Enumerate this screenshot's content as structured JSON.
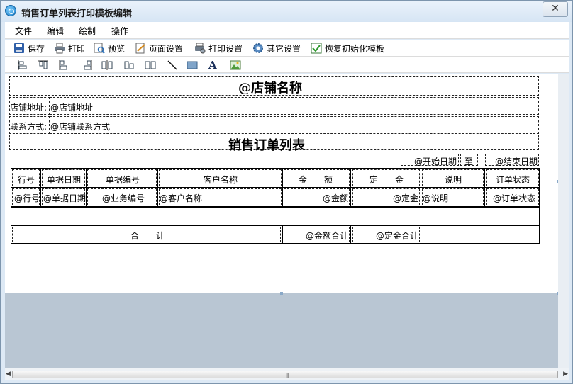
{
  "window": {
    "title": "销售订单列表打印模板编辑",
    "close_label": "✕"
  },
  "menu": [
    "文件",
    "编辑",
    "绘制",
    "操作"
  ],
  "toolbar": [
    {
      "icon": "save-icon",
      "label": "保存"
    },
    {
      "icon": "print-icon",
      "label": "打印"
    },
    {
      "icon": "preview-icon",
      "label": "预览"
    },
    {
      "icon": "page-setup-icon",
      "label": "页面设置"
    },
    {
      "icon": "print-setup-icon",
      "label": "打印设置"
    },
    {
      "icon": "gear-icon",
      "label": "其它设置"
    },
    {
      "icon": "restore-icon",
      "label": "恢复初始化模板"
    }
  ],
  "drawbar": [
    "align-left-icon",
    "align-top-icon",
    "align-bottom-left-icon",
    "align-bottom-right-icon",
    "distribute-h-icon",
    "same-height-icon",
    "same-width-icon",
    "line-icon",
    "rectangle-icon",
    "text-icon",
    "image-icon"
  ],
  "template": {
    "shop_name": "@店铺名称",
    "address_label": "店铺地址:",
    "address_value": "@店铺地址",
    "contact_label": "联系方式:",
    "contact_value": "@店铺联系方式",
    "report_title": "销售订单列表",
    "start_date": "@开始日期",
    "to_label": "至",
    "end_date": "@结束日期",
    "headers": [
      "行号",
      "单据日期",
      "单据编号",
      "客户名称",
      "金　　额",
      "定　　金",
      "说明",
      "订单状态"
    ],
    "row": [
      "@行号",
      "@单据日期",
      "@业务编号",
      "@客户名称",
      "@金额",
      "@定金",
      "@说明",
      "@订单状态"
    ],
    "total_label": "合　　计",
    "total_amount": "@金额合计",
    "total_deposit": "@定金合计"
  },
  "scrollbar": {
    "grip": "|||"
  }
}
